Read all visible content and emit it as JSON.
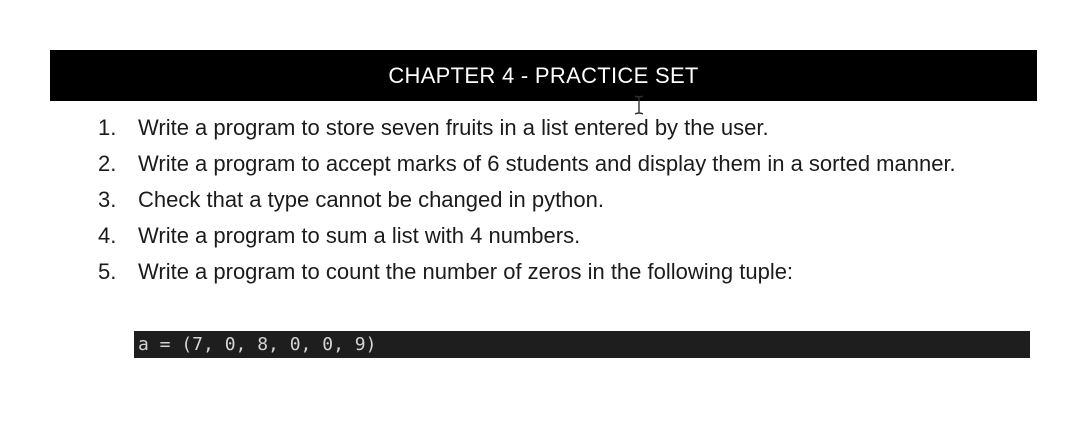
{
  "header": {
    "title": "CHAPTER 4 - PRACTICE SET"
  },
  "practice_set": {
    "items": [
      {
        "number": "1.",
        "text": "Write a program to store seven fruits in a list entered by the user."
      },
      {
        "number": "2.",
        "text": "Write a program to accept marks of 6 students and display them in a sorted manner."
      },
      {
        "number": "3.",
        "text": "Check that a type cannot be changed in python."
      },
      {
        "number": "4.",
        "text": "Write a program to sum a list with 4 numbers."
      },
      {
        "number": "5.",
        "text": "Write a program to count the number of zeros in the following tuple:"
      }
    ]
  },
  "code": {
    "line": "a = (7, 0, 8, 0, 0, 9)"
  },
  "icons": {
    "cursor": "text-cursor-icon"
  },
  "colors": {
    "header_bg": "#000000",
    "header_text": "#ffffff",
    "code_bg": "#1e1e1e",
    "code_text": "#d4d4d4",
    "body_text": "#1b1b1b"
  }
}
